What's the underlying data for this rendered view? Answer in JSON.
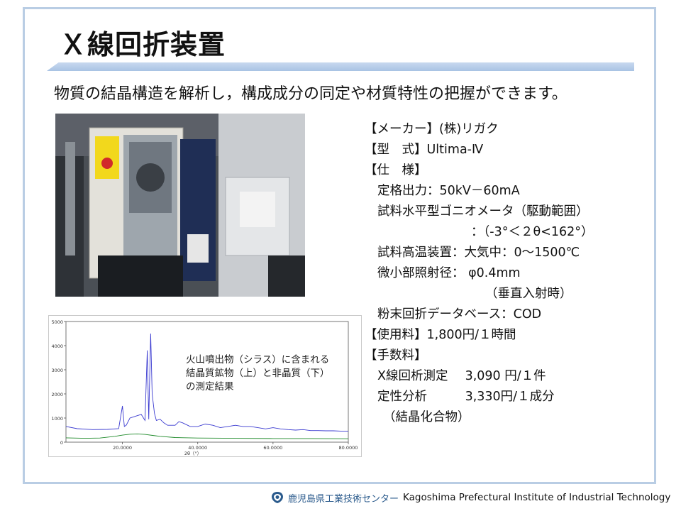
{
  "slide": {
    "title": "Ｘ線回折装置",
    "subtitle": "物質の結晶構造を解析し，構成成分の同定や材質特性の把握ができます。"
  },
  "photo": {
    "icon": "x-ray-diffractometer-photo"
  },
  "specs": {
    "maker": "【メーカー】(株)リガク",
    "model": "【型　式】Ultima-Ⅳ",
    "spec_header": "【仕　様】",
    "rated_output": "定格出力：50kV－60mA",
    "goniometer": "試料水平型ゴニオメータ（駆動範囲）",
    "goniometer_range": "：（-3°＜２θ<162°）",
    "high_temp": "試料高温装置：大気中：0～1500℃",
    "micro_label": "微小部照射径：",
    "micro_value": "φ0.4mm",
    "micro_note": "（垂直入射時）",
    "database": "粉末回折データベース：COD",
    "usage_fee": "【使用料】1,800円/１時間",
    "handling_header": "【手数料】",
    "fee1_label": "X線回析測定",
    "fee1_value": "3,090 円/１件",
    "fee2_label": "定性分析",
    "fee2_value": "3,330円/１成分",
    "fee2_note": "（結晶化合物）"
  },
  "chart_note": {
    "line1": "火山噴出物（シラス）に含まれる",
    "line2": "結晶質鉱物（上）と非晶質（下）",
    "line3": "の測定結果"
  },
  "chart_data": {
    "type": "line",
    "title": "",
    "xlabel": "2θ（°）",
    "ylabel": "",
    "xlim": [
      5,
      80
    ],
    "ylim": [
      0,
      5000
    ],
    "xticks": [
      "20.0000",
      "40.0000",
      "60.0000",
      "80.0000"
    ],
    "yticks": [
      "0",
      "1000",
      "2000",
      "3000",
      "4000",
      "5000"
    ],
    "grid": false,
    "series": [
      {
        "color": "#3a3ad0",
        "x": [
          5,
          8,
          12,
          16,
          19,
          20,
          20.5,
          21,
          22,
          23,
          24,
          25,
          26,
          26.6,
          27,
          27.5,
          27.9,
          28.5,
          29,
          30,
          31,
          32,
          34,
          35,
          36,
          38,
          40,
          42,
          44,
          46,
          48,
          50,
          52,
          54,
          56,
          58,
          60,
          62,
          64,
          66,
          68,
          70,
          72,
          74,
          76,
          78,
          80
        ],
        "y": [
          650,
          560,
          520,
          530,
          560,
          1500,
          650,
          700,
          1000,
          1050,
          1100,
          1150,
          900,
          3800,
          950,
          4500,
          2000,
          1200,
          900,
          950,
          800,
          700,
          700,
          850,
          800,
          650,
          650,
          750,
          700,
          600,
          650,
          700,
          650,
          650,
          600,
          550,
          600,
          550,
          520,
          500,
          520,
          480,
          480,
          470,
          470,
          460,
          460
        ]
      },
      {
        "color": "#1f8a2a",
        "x": [
          5,
          10,
          14,
          18,
          20,
          22,
          24,
          26,
          28,
          30,
          34,
          40,
          50,
          60,
          70,
          80
        ],
        "y": [
          180,
          160,
          170,
          240,
          290,
          330,
          340,
          320,
          280,
          240,
          190,
          170,
          160,
          150,
          150,
          140
        ]
      }
    ]
  },
  "footer": {
    "logo_icon": "kagoshima-pref-logo-icon",
    "jp": "鹿児島県工業技術センター",
    "en": "Kagoshima Prefectural Institute of Industrial Technology"
  }
}
